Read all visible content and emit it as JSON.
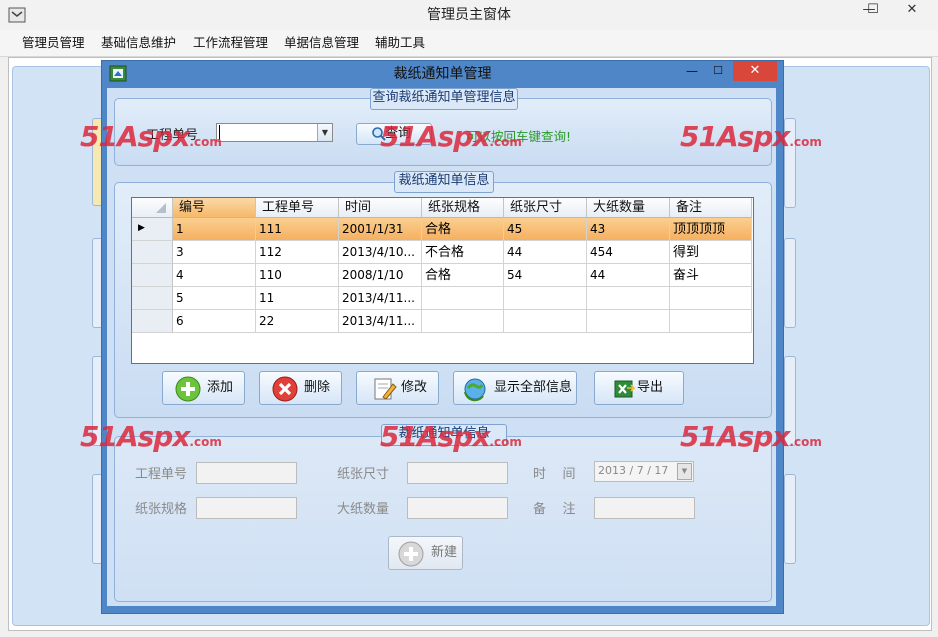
{
  "main_window": {
    "title": "管理员主窗体",
    "controls": {
      "minimize": "—",
      "maximize": "☐",
      "close": "✕"
    }
  },
  "menu": [
    "管理员管理",
    "基础信息维护",
    "工作流程管理",
    "单据信息管理",
    "辅助工具"
  ],
  "dialog": {
    "title": "裁纸通知单管理",
    "controls": {
      "minimize": "—",
      "maximize": "☐",
      "close": "✕"
    }
  },
  "query": {
    "legend": "查询裁纸通知单管理信息",
    "field_label": "工程单号",
    "input_value": "",
    "button_label": "查询",
    "hint": "可以按回车键查询!"
  },
  "grid": {
    "legend": "裁纸通知单信息",
    "columns": [
      "编号",
      "工程单号",
      "时间",
      "纸张规格",
      "纸张尺寸",
      "大纸数量",
      "备注"
    ],
    "rows": [
      [
        "1",
        "111",
        "2001/1/31",
        "合格",
        "45",
        "43",
        "顶顶顶顶"
      ],
      [
        "3",
        "112",
        "2013/4/10...",
        "不合格",
        "44",
        "454",
        "得到"
      ],
      [
        "4",
        "110",
        "2008/1/10",
        "合格",
        "54",
        "44",
        "奋斗"
      ],
      [
        "5",
        "11",
        "2013/4/11...",
        "",
        "",
        "",
        ""
      ],
      [
        "6",
        "22",
        "2013/4/11...",
        "",
        "",
        "",
        ""
      ]
    ],
    "selected_row": 0
  },
  "actions": {
    "add": "添加",
    "delete": "删除",
    "edit": "修改",
    "show_all": "显示全部信息",
    "export": "导出"
  },
  "detail": {
    "legend": "裁纸通知单信息",
    "project_no": "工程单号",
    "paper_size": "纸张尺寸",
    "time_label": "时    间",
    "date_value": "2013 / 7 / 17",
    "paper_spec": "纸张规格",
    "big_paper_qty": "大纸数量",
    "remark_label": "备    注",
    "new_button": "新建"
  },
  "watermark": {
    "brand": "51Aspx",
    "suffix": ".com"
  },
  "colors": {
    "selected_row": "#f7b96a",
    "dialog_frame": "#4e86c8",
    "close_red": "#d9463a",
    "hint_green": "#2a9a2a"
  }
}
